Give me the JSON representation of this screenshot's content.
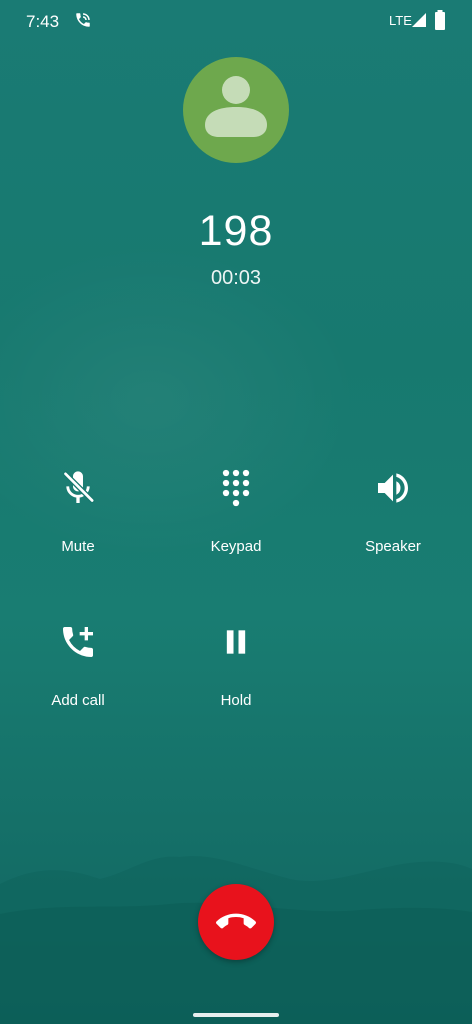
{
  "status_bar": {
    "time": "7:43",
    "network": "LTE",
    "call_icon": "phone-in-talk-icon",
    "signal_icon": "cell-signal-icon",
    "battery_icon": "battery-icon"
  },
  "caller": {
    "avatar_icon": "person-icon",
    "avatar_color": "#6ea84d",
    "number": "198",
    "duration": "00:03"
  },
  "controls": [
    {
      "label": "Mute",
      "icon": "mic-off-icon"
    },
    {
      "label": "Keypad",
      "icon": "dialpad-icon"
    },
    {
      "label": "Speaker",
      "icon": "volume-up-icon"
    },
    {
      "label": "Add call",
      "icon": "add-call-icon"
    },
    {
      "label": "Hold",
      "icon": "pause-icon"
    }
  ],
  "end_call": {
    "icon": "call-end-icon",
    "color": "#e8121c"
  },
  "colors": {
    "background": "#17796f"
  }
}
